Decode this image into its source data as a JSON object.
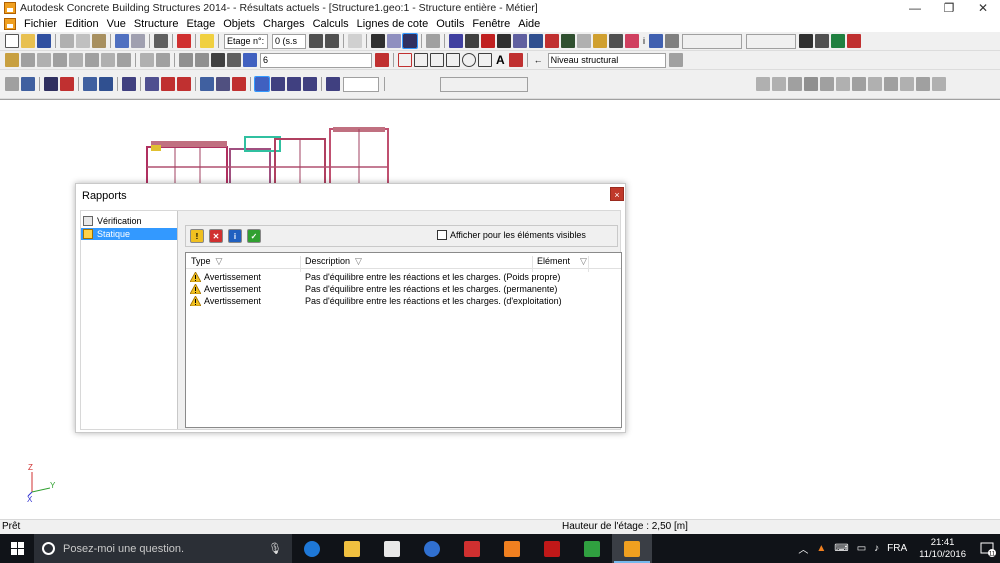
{
  "window": {
    "title": "Autodesk Concrete Building Structures 2014- - Résultats actuels - [Structure1.geo:1 - Structure entière - Métier]"
  },
  "menu": {
    "items": [
      "Fichier",
      "Edition",
      "Vue",
      "Structure",
      "Etage",
      "Objets",
      "Charges",
      "Calculs",
      "Lignes de cote",
      "Outils",
      "Fenêtre",
      "Aide"
    ]
  },
  "toolbar1": {
    "etage_label": "Etage n°:",
    "etage_value": "0 (s.s",
    "eye_value": "i"
  },
  "toolbar2": {
    "layer_value": "6",
    "structure_level": "Niveau structural"
  },
  "axes": {
    "z": "Z",
    "y": "Y",
    "x": "X"
  },
  "status": {
    "left": "Prêt",
    "right": "Hauteur de l'étage : 2,50 [m]"
  },
  "dialog": {
    "title": "Rapports",
    "close": "×",
    "tree": [
      "Vérification",
      "Statique"
    ],
    "checkbox_label": "Afficher pour les éléments visibles",
    "columns": {
      "type": "Type",
      "description": "Description",
      "element": "Elément"
    },
    "rows": [
      {
        "type": "Avertissement",
        "description": "Pas d'équilibre entre les réactions et les charges. (Poids propre)"
      },
      {
        "type": "Avertissement",
        "description": "Pas d'équilibre entre les réactions et les charges. (permanente)"
      },
      {
        "type": "Avertissement",
        "description": "Pas d'équilibre entre les réactions et les charges. (d'exploitation)"
      }
    ]
  },
  "taskbar": {
    "search_placeholder": "Posez-moi une question.",
    "language": "FRA",
    "time": "21:41",
    "date": "11/10/2016",
    "notification_count": "11"
  }
}
